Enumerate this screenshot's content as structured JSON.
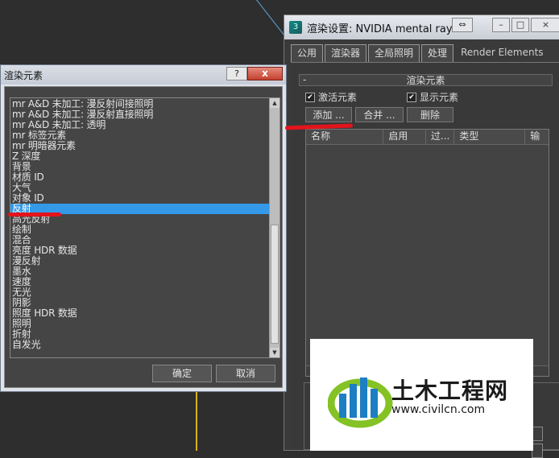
{
  "render_setup": {
    "title": "渲染设置: NVIDIA mental ray",
    "tabs": [
      "公用",
      "渲染器",
      "全局照明",
      "处理",
      "Render Elements"
    ],
    "rollout_title": "渲染元素",
    "rollout_minus": "-",
    "active_elements_label": "激活元素",
    "display_elements_label": "显示元素",
    "add_label": "添加 ...",
    "merge_label": "合并 ...",
    "delete_label": "删除",
    "columns": [
      "名称",
      "启用",
      "过...",
      "类型",
      "输"
    ]
  },
  "render_elements_dialog": {
    "title": "渲染元素",
    "help_label": "?",
    "close_label": "x",
    "items": [
      "mr A&D 未加工: 漫反射间接照明",
      "mr A&D 未加工: 漫反射直接照明",
      "mr A&D 未加工: 透明",
      "mr 标签元素",
      "mr 明暗器元素",
      "Z 深度",
      "背景",
      "材质 ID",
      "大气",
      "对象 ID",
      "反射",
      "高光反射",
      "绘制",
      "混合",
      "亮度 HDR 数据",
      "漫反射",
      "墨水",
      "速度",
      "无光",
      "阴影",
      "照度 HDR 数据",
      "照明",
      "折射",
      "自发光"
    ],
    "selected_index": 10,
    "ok_label": "确定",
    "cancel_label": "取消"
  },
  "watermark": {
    "brand": "土木工程网",
    "url": "www.civilcn.com"
  },
  "colors": {
    "selection": "#3399e8",
    "annotation_red": "#e3141c",
    "dark_panel": "#393939"
  }
}
